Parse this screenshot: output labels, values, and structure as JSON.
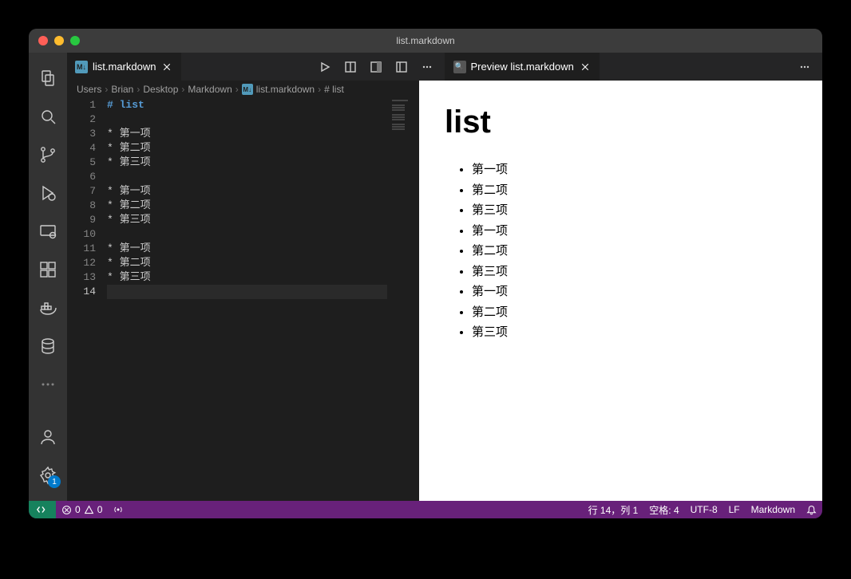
{
  "window": {
    "title": "list.markdown"
  },
  "tabs": {
    "editor": {
      "label": "list.markdown"
    },
    "preview": {
      "label": "Preview list.markdown"
    }
  },
  "breadcrumbs": {
    "p0": "Users",
    "p1": "Brian",
    "p2": "Desktop",
    "p3": "Markdown",
    "p4": "list.markdown",
    "p5": "# list"
  },
  "editor": {
    "lines": {
      "l1": "# list",
      "l2": "",
      "l3": "* 第一项",
      "l4": "* 第二项",
      "l5": "* 第三项",
      "l6": "",
      "l7": "* 第一项",
      "l8": "* 第二项",
      "l9": "* 第三项",
      "l10": "",
      "l11": "* 第一项",
      "l12": "* 第二项",
      "l13": "* 第三项",
      "l14": ""
    },
    "gutter": {
      "n1": "1",
      "n2": "2",
      "n3": "3",
      "n4": "4",
      "n5": "5",
      "n6": "6",
      "n7": "7",
      "n8": "8",
      "n9": "9",
      "n10": "10",
      "n11": "11",
      "n12": "12",
      "n13": "13",
      "n14": "14"
    }
  },
  "preview": {
    "heading": "list",
    "items": {
      "i0": "第一项",
      "i1": "第二项",
      "i2": "第三项",
      "i3": "第一项",
      "i4": "第二项",
      "i5": "第三项",
      "i6": "第一项",
      "i7": "第二项",
      "i8": "第三项"
    }
  },
  "status": {
    "errors": "0",
    "warnings": "0",
    "cursor": "行 14，列 1",
    "spaces": "空格: 4",
    "encoding": "UTF-8",
    "eol": "LF",
    "language": "Markdown"
  },
  "activity": {
    "settings_badge": "1"
  }
}
